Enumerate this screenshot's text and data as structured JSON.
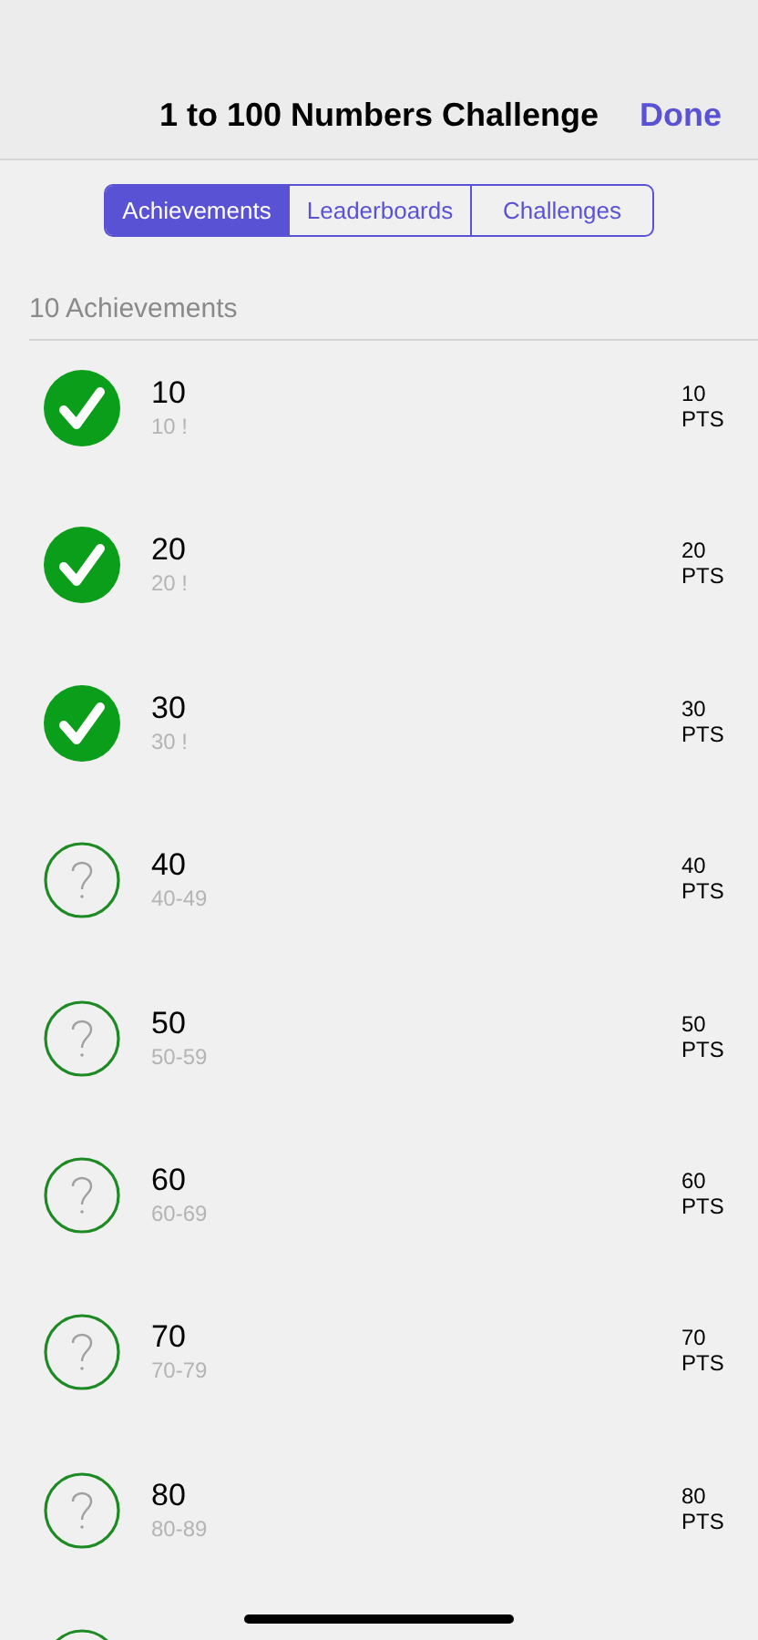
{
  "header": {
    "title": "1 to 100 Numbers Challenge",
    "done": "Done"
  },
  "tabs": [
    {
      "label": "Achievements",
      "selected": true
    },
    {
      "label": "Leaderboards",
      "selected": false
    },
    {
      "label": "Challenges",
      "selected": false
    }
  ],
  "section": {
    "title": "10 Achievements"
  },
  "achievements": [
    {
      "title": "10",
      "subtitle": "10 !",
      "points": "10",
      "unit": "PTS",
      "achieved": true
    },
    {
      "title": "20",
      "subtitle": "20 !",
      "points": "20",
      "unit": "PTS",
      "achieved": true
    },
    {
      "title": "30",
      "subtitle": "30 !",
      "points": "30",
      "unit": "PTS",
      "achieved": true
    },
    {
      "title": "40",
      "subtitle": "40-49",
      "points": "40",
      "unit": "PTS",
      "achieved": false
    },
    {
      "title": "50",
      "subtitle": "50-59",
      "points": "50",
      "unit": "PTS",
      "achieved": false
    },
    {
      "title": "60",
      "subtitle": "60-69",
      "points": "60",
      "unit": "PTS",
      "achieved": false
    },
    {
      "title": "70",
      "subtitle": "70-79",
      "points": "70",
      "unit": "PTS",
      "achieved": false
    },
    {
      "title": "80",
      "subtitle": "80-89",
      "points": "80",
      "unit": "PTS",
      "achieved": false
    },
    {
      "achieved": false
    }
  ]
}
